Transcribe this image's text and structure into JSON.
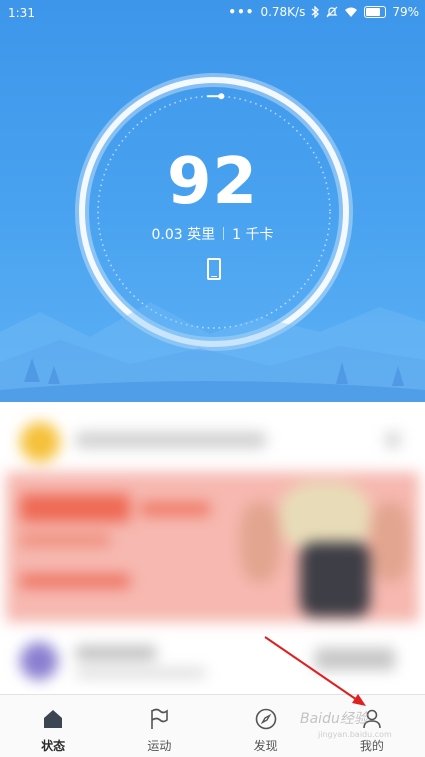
{
  "status_bar": {
    "time": "1:31",
    "network_speed": "0.78K/s",
    "battery": "79%"
  },
  "summary": {
    "steps": "92",
    "distance": "0.03 英里",
    "calories": "1 千卡",
    "ring_progress": 0.01
  },
  "colors": {
    "hero_top": "#3d96ea",
    "hero_bottom": "#5eb2f5",
    "ring": "#ffffff"
  },
  "tabs": [
    {
      "label": "状态",
      "icon": "home-icon",
      "active": true
    },
    {
      "label": "运动",
      "icon": "flag-icon",
      "active": false
    },
    {
      "label": "发现",
      "icon": "compass-icon",
      "active": false
    },
    {
      "label": "我的",
      "icon": "person-icon",
      "active": false
    }
  ],
  "watermark": {
    "text": "Baidu经验",
    "url_text": "jingyan.baidu.com"
  }
}
